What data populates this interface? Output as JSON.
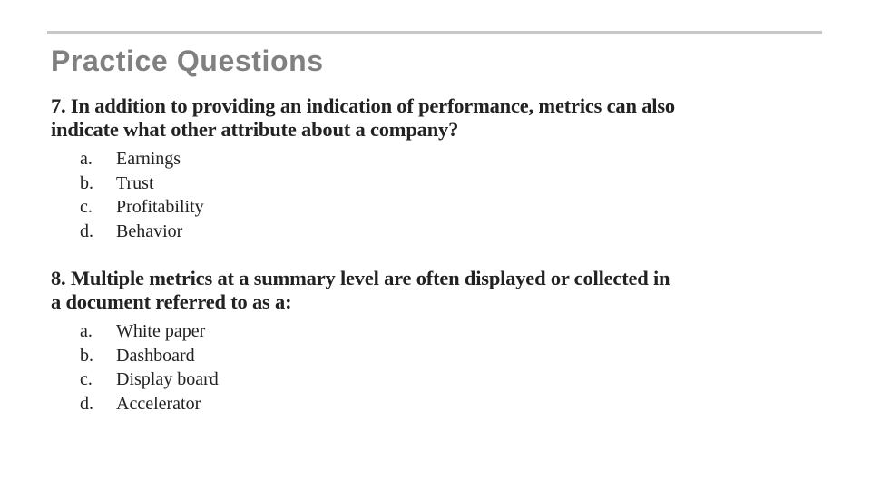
{
  "slide": {
    "title": "Practice Questions",
    "accent_rule_color": "#c8c8c8",
    "title_color": "#808080"
  },
  "questions": [
    {
      "text": "7. In addition to providing an indication of performance, metrics can also indicate what other attribute about a company?",
      "line1": "7. In addition to providing an indication of performance, metrics can also",
      "line2": "indicate what other attribute about a company?",
      "options": [
        {
          "letter": "a.",
          "label": "Earnings"
        },
        {
          "letter": "b.",
          "label": "Trust"
        },
        {
          "letter": "c.",
          "label": "Profitability"
        },
        {
          "letter": "d.",
          "label": "Behavior"
        }
      ]
    },
    {
      "text": "8. Multiple metrics at a summary level are often displayed or collected in a document referred to as a:",
      "line1": "8. Multiple metrics at a summary level are often displayed or collected in",
      "line2": "a document referred to as a:",
      "options": [
        {
          "letter": "a.",
          "label": "White paper"
        },
        {
          "letter": "b.",
          "label": "Dashboard"
        },
        {
          "letter": "c.",
          "label": "Display board"
        },
        {
          "letter": "d.",
          "label": "Accelerator"
        }
      ]
    }
  ]
}
